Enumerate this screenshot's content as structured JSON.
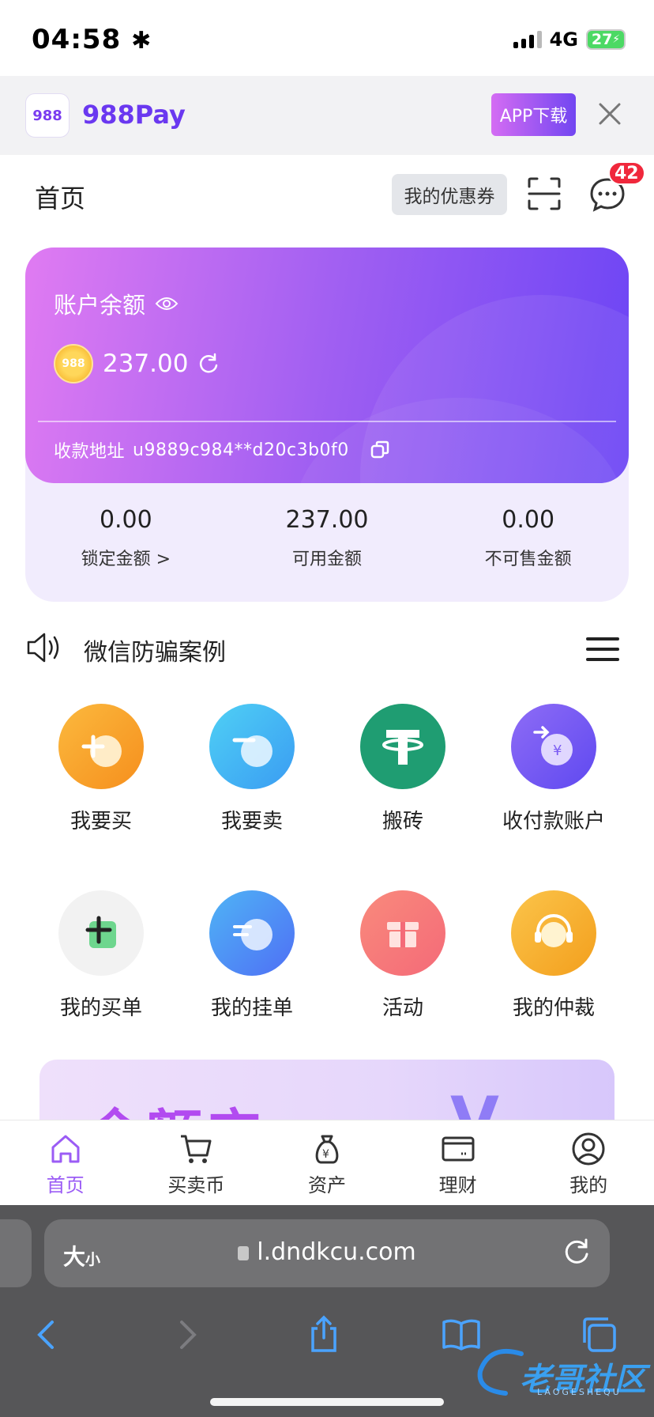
{
  "status_bar": {
    "time": "04:58",
    "network": "4G",
    "battery": "27"
  },
  "download_banner": {
    "logo_text": "988",
    "title": "988Pay",
    "button": "APP下载"
  },
  "header": {
    "title": "首页",
    "coupon_button": "我的优惠券",
    "message_badge": "42"
  },
  "balance": {
    "label": "账户余额",
    "coin_text": "988",
    "amount": "237.00",
    "address_label": "收款地址",
    "address_value": "u9889c984**d20c3b0f0",
    "stats": [
      {
        "value": "0.00",
        "label": "锁定金额 >"
      },
      {
        "value": "237.00",
        "label": "可用金额"
      },
      {
        "value": "0.00",
        "label": "不可售金额"
      }
    ]
  },
  "notice": {
    "text": "微信防骗案例"
  },
  "features": [
    {
      "label": "我要买",
      "icon": "plus-circle-icon",
      "color": "#f8a92b"
    },
    {
      "label": "我要卖",
      "icon": "minus-circle-icon",
      "color": "#3fb7f4"
    },
    {
      "label": "搬砖",
      "icon": "tether-icon",
      "color": "#1f9d72"
    },
    {
      "label": "收付款账户",
      "icon": "yuan-transfer-icon",
      "color": "#7b5cf3"
    },
    {
      "label": "我的买单",
      "icon": "add-order-icon",
      "color": "#f2f2f2"
    },
    {
      "label": "我的挂单",
      "icon": "order-list-icon",
      "color": "#4f7ff5"
    },
    {
      "label": "活动",
      "icon": "gift-icon",
      "color": "#f87171"
    },
    {
      "label": "我的仲裁",
      "icon": "headset-icon",
      "color": "#f8a92b"
    }
  ],
  "promo": {
    "text": "余额宝",
    "letter": "V"
  },
  "tabbar": [
    {
      "label": "首页",
      "icon": "home-icon",
      "active": true
    },
    {
      "label": "买卖币",
      "icon": "cart-icon",
      "active": false
    },
    {
      "label": "资产",
      "icon": "money-bag-icon",
      "active": false
    },
    {
      "label": "理财",
      "icon": "card-icon",
      "active": false
    },
    {
      "label": "我的",
      "icon": "profile-icon",
      "active": false
    }
  ],
  "browser": {
    "text_size_big": "大",
    "text_size_small": "小",
    "url": "l.dndkcu.com"
  },
  "watermark": {
    "text": "老哥社区",
    "sub": "LAOGESHEQU"
  },
  "colors": {
    "accent": "#7a46f2",
    "gradient_start": "#e07bf2",
    "gradient_end": "#6b44f5",
    "badge": "#f0283c"
  }
}
